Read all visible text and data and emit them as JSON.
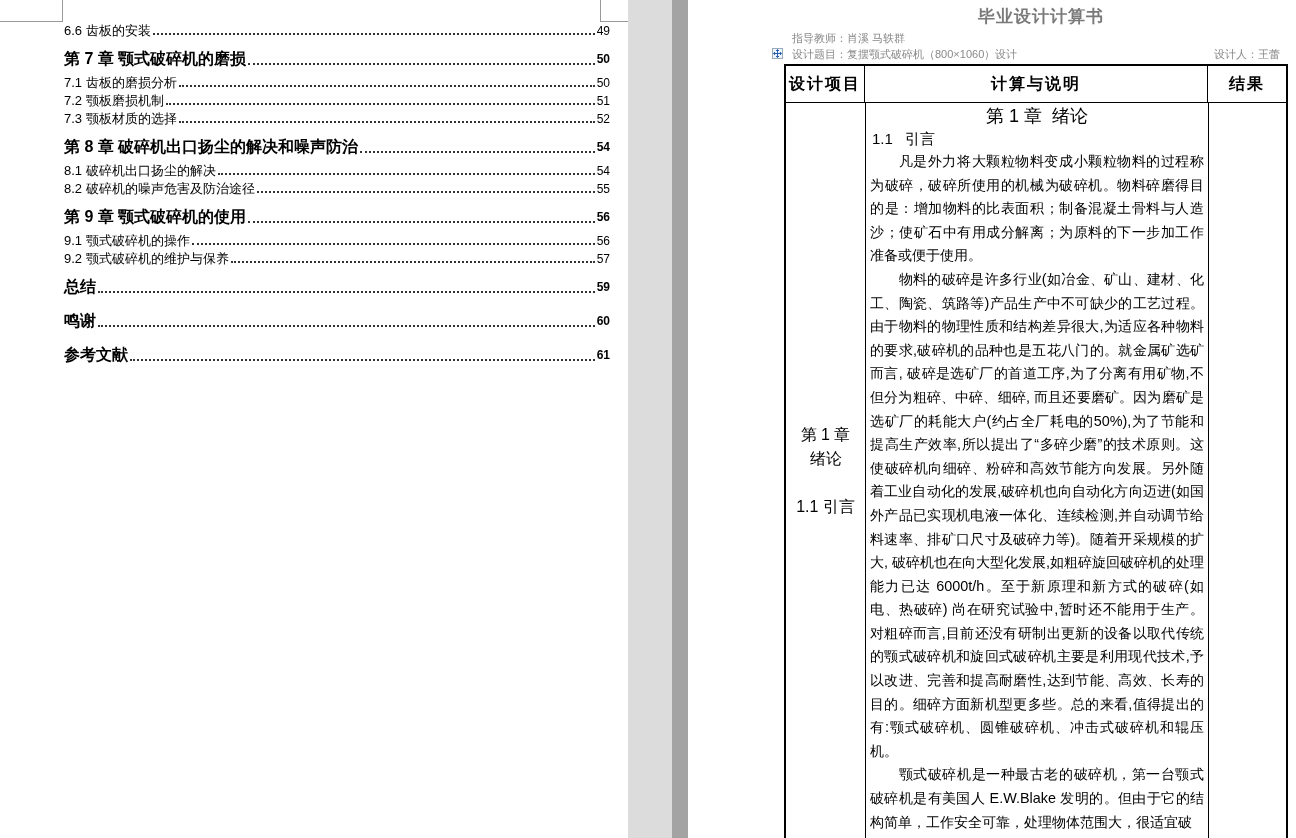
{
  "toc": [
    {
      "kind": "section",
      "title": "6.6 齿板的安装",
      "page": "49"
    },
    {
      "kind": "chapter",
      "title": "第 7 章  颚式破碎机的磨损",
      "page": "50"
    },
    {
      "kind": "section",
      "title": "7.1 齿板的磨损分析",
      "page": "50"
    },
    {
      "kind": "section",
      "title": "7.2 颚板磨损机制",
      "page": "51"
    },
    {
      "kind": "section",
      "title": "7.3 颚板材质的选择",
      "page": "52"
    },
    {
      "kind": "chapter",
      "title": "第 8 章  破碎机出口扬尘的解决和噪声防治",
      "page": "54"
    },
    {
      "kind": "section",
      "title": "8.1 破碎机出口扬尘的解决",
      "page": "54"
    },
    {
      "kind": "section",
      "title": "8.2 破碎机的噪声危害及防治途径",
      "page": "55"
    },
    {
      "kind": "chapter",
      "title": "第 9 章  颚式破碎机的使用",
      "page": "56"
    },
    {
      "kind": "section",
      "title": "9.1 颚式破碎机的操作",
      "page": "56"
    },
    {
      "kind": "section",
      "title": "9.2 颚式破碎机的维护与保养",
      "page": "57"
    },
    {
      "kind": "chapter",
      "title": "总结",
      "page": "59"
    },
    {
      "kind": "chapter",
      "title": "鸣谢",
      "page": "60"
    },
    {
      "kind": "chapter",
      "title": "参考文献",
      "page": "61"
    }
  ],
  "document": {
    "header_title": "毕业设计计算书",
    "advisor": "指导教师：肖溪 马轶群",
    "topic": "设计题目：复摆颚式破碎机（800×1060）设计",
    "designer": "设计人：王蕾",
    "table": {
      "columns": [
        "设计项目",
        "计算与说明",
        "结果"
      ],
      "item": [
        "第 1 章",
        "绪论",
        "1.1 引言"
      ],
      "chapter_title": "第 1 章  绪论",
      "section_title": "1.1   引言",
      "paragraphs": [
        "凡是外力将大颗粒物料变成小颗粒物料的过程称为破碎，破碎所使用的机械为破碎机。物料碎磨得目的是：增加物料的比表面积；制备混凝土骨料与人造沙；使矿石中有用成分解离；为原料的下一步加工作准备或便于使用。",
        "物料的破碎是许多行业(如冶金、矿山、建材、化工、陶瓷、筑路等)产品生产中不可缺少的工艺过程。由于物料的物理性质和结构差异很大,为适应各种物料的要求,破碎机的品种也是五花八门的。就金属矿选矿而言, 破碎是选矿厂的首道工序,为了分离有用矿物,不但分为粗碎、中碎、细碎, 而且还要磨矿。因为磨矿是选矿厂的耗能大户(约占全厂耗电的50%),为了节能和提高生产效率,所以提出了“多碎少磨”的技术原则。这使破碎机向细碎、粉碎和高效节能方向发展。另外随着工业自动化的发展,破碎机也向自动化方向迈进(如国外产品已实现机电液一体化、连续检测,并自动调节给料速率、排矿口尺寸及破碎力等)。随着开采规模的扩大, 破碎机也在向大型化发展,如粗碎旋回破碎机的处理能力已达 6000t/h。至于新原理和新方式的破碎(如电、热破碎) 尚在研究试验中,暂时还不能用于生产。对粗碎而言,目前还没有研制出更新的设备以取代传统的颚式破碎机和旋回式破碎机主要是利用现代技术,予以改进、完善和提高耐磨性,达到节能、高效、长寿的目的。细碎方面新机型更多些。总的来看,值得提出的有:颚式破碎机、圆锥破碎机、冲击式破碎机和辊压机。",
        "颚式破碎机是一种最古老的破碎机，第一台颚式破碎机是有美国人 E.W.Blake 发明的。但由于它的结构简单，工作安全可靠，处理物体范围大，很适宜破"
      ]
    }
  }
}
